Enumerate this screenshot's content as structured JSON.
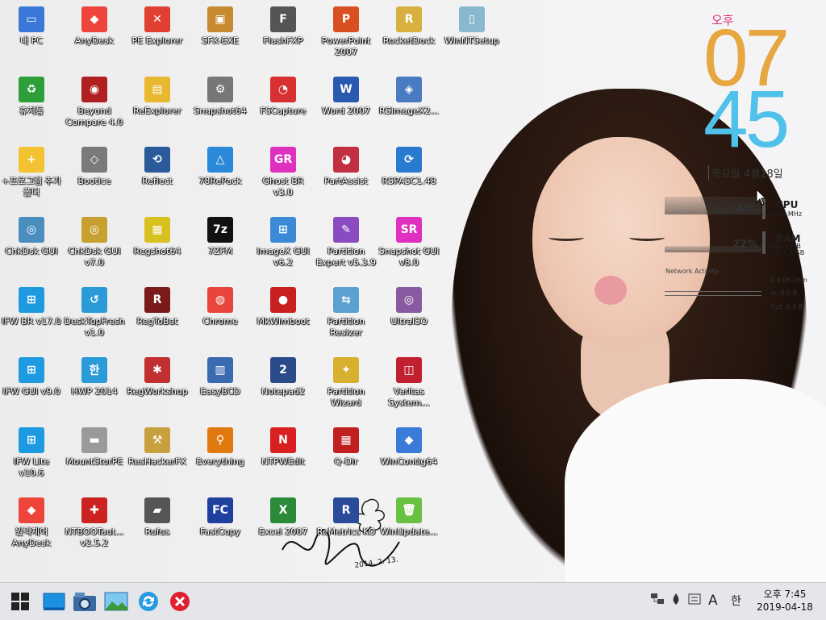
{
  "desktop_icons": [
    {
      "label": "내 PC",
      "icon": "monitor-icon",
      "color": "#3a78d8",
      "glyph": "▭"
    },
    {
      "label": "휴지통",
      "icon": "recycle-bin-icon",
      "color": "#2e9e3a",
      "glyph": "♻"
    },
    {
      "label": "+프로그램 추가 폴더",
      "icon": "folder-add-icon",
      "color": "#f2c230",
      "glyph": "+"
    },
    {
      "label": "ChkDsk GUI",
      "icon": "disk-check-icon",
      "color": "#4a8ec0",
      "glyph": "◎"
    },
    {
      "label": "IFW BR v17.0",
      "icon": "windows-tile-icon",
      "color": "#1e9be0",
      "glyph": "⊞"
    },
    {
      "label": "IFW GUI v9.0",
      "icon": "windows-tile-icon",
      "color": "#1e9be0",
      "glyph": "⊞"
    },
    {
      "label": "IFW Lite v10.6",
      "icon": "windows-tile-icon",
      "color": "#1e9be0",
      "glyph": "⊞"
    },
    {
      "label": "원격제어 AnyDesk",
      "icon": "anydesk-icon",
      "color": "#ef443b",
      "glyph": "◆"
    },
    {
      "label": "AnyDesk",
      "icon": "anydesk-icon",
      "color": "#ef443b",
      "glyph": "◆"
    },
    {
      "label": "Beyond Compare 4.0",
      "icon": "beyond-compare-icon",
      "color": "#b02020",
      "glyph": "◉"
    },
    {
      "label": "Bootice",
      "icon": "bootice-icon",
      "color": "#7a7a7a",
      "glyph": "◇"
    },
    {
      "label": "ChkDsk GUI v7.0",
      "icon": "disk-check-icon",
      "color": "#c8a030",
      "glyph": "◎"
    },
    {
      "label": "DeskTopFresh v1.0",
      "icon": "refresh-arrow-icon",
      "color": "#2a9ad8",
      "glyph": "↺"
    },
    {
      "label": "HWP 2014",
      "icon": "hwp-icon",
      "color": "#2a9ad8",
      "glyph": "한"
    },
    {
      "label": "MountStorPE",
      "icon": "drive-icon",
      "color": "#9a9a9a",
      "glyph": "▬"
    },
    {
      "label": "NTBOOTaut... v2.5.2",
      "icon": "toolbox-icon",
      "color": "#cc2222",
      "glyph": "✚"
    },
    {
      "label": "PE Explorer",
      "icon": "pe-explorer-icon",
      "color": "#e04030",
      "glyph": "✕"
    },
    {
      "label": "ReExplorer",
      "icon": "folder-window-icon",
      "color": "#e8b830",
      "glyph": "▤"
    },
    {
      "label": "Reflect",
      "icon": "reflect-icon",
      "color": "#2a5a9a",
      "glyph": "⟲"
    },
    {
      "label": "Regshot64",
      "icon": "regshot-icon",
      "color": "#d8c020",
      "glyph": "▦"
    },
    {
      "label": "RegToBat",
      "icon": "regtobat-icon",
      "color": "#7a1a1a",
      "glyph": "R"
    },
    {
      "label": "RegWorkshop",
      "icon": "regworkshop-icon",
      "color": "#c03030",
      "glyph": "✱"
    },
    {
      "label": "ResHackerFX",
      "icon": "reshacker-icon",
      "color": "#c8a040",
      "glyph": "⚒"
    },
    {
      "label": "Rufus",
      "icon": "usb-drive-icon",
      "color": "#555555",
      "glyph": "▰"
    },
    {
      "label": "SFX-EXE",
      "icon": "package-icon",
      "color": "#c88a30",
      "glyph": "▣"
    },
    {
      "label": "Snapshot64",
      "icon": "snapshot-icon",
      "color": "#777777",
      "glyph": "⚙"
    },
    {
      "label": "78RePack",
      "icon": "repack-icon",
      "color": "#2a8ad8",
      "glyph": "△"
    },
    {
      "label": "7ZFM",
      "icon": "seven-zip-icon",
      "color": "#111111",
      "glyph": "7z"
    },
    {
      "label": "Chrome",
      "icon": "chrome-icon",
      "color": "#e8453c",
      "glyph": "◍"
    },
    {
      "label": "EasyBCD",
      "icon": "easybcd-icon",
      "color": "#3a6ab0",
      "glyph": "▥"
    },
    {
      "label": "Everything",
      "icon": "magnifier-icon",
      "color": "#e07a10",
      "glyph": "⚲"
    },
    {
      "label": "FastCopy",
      "icon": "fastcopy-icon",
      "color": "#2040a0",
      "glyph": "FC"
    },
    {
      "label": "FlashFXP",
      "icon": "flashfxp-icon",
      "color": "#555555",
      "glyph": "F"
    },
    {
      "label": "FSCapture",
      "icon": "fscapture-icon",
      "color": "#d83030",
      "glyph": "◔"
    },
    {
      "label": "Ghost BR v3.0",
      "icon": "ghost-br-icon",
      "color": "#e030c0",
      "glyph": "GR"
    },
    {
      "label": "ImageX GUI v6.2",
      "icon": "windows-flag-icon",
      "color": "#3a8ad8",
      "glyph": "⊞"
    },
    {
      "label": "MkWimboot",
      "icon": "ladybug-icon",
      "color": "#c82020",
      "glyph": "●"
    },
    {
      "label": "Notepad2",
      "icon": "notepad2-icon",
      "color": "#2a4a8a",
      "glyph": "2"
    },
    {
      "label": "NTPWEdit",
      "icon": "ntpwedit-icon",
      "color": "#d82020",
      "glyph": "N"
    },
    {
      "label": "Excel 2007",
      "icon": "excel-icon",
      "color": "#2a8a3a",
      "glyph": "X"
    },
    {
      "label": "PowerPoint 2007",
      "icon": "powerpoint-icon",
      "color": "#d85020",
      "glyph": "P"
    },
    {
      "label": "Word 2007",
      "icon": "word-icon",
      "color": "#2a5ab0",
      "glyph": "W"
    },
    {
      "label": "PartAssist",
      "icon": "partassist-icon",
      "color": "#c03040",
      "glyph": "◕"
    },
    {
      "label": "Partition Expert v5.3.9",
      "icon": "partition-expert-icon",
      "color": "#8a4ac0",
      "glyph": "✎"
    },
    {
      "label": "Partition Resizer",
      "icon": "partition-resizer-icon",
      "color": "#5aa0d0",
      "glyph": "⇆"
    },
    {
      "label": "Partition Wizard",
      "icon": "partition-wizard-icon",
      "color": "#d8b030",
      "glyph": "✦"
    },
    {
      "label": "Q-Dir",
      "icon": "q-dir-icon",
      "color": "#c02020",
      "glyph": "▦"
    },
    {
      "label": "ReMetrics KO",
      "icon": "remetrics-icon",
      "color": "#2a4a9a",
      "glyph": "R"
    },
    {
      "label": "RocketDock",
      "icon": "rocketdock-icon",
      "color": "#d8b040",
      "glyph": "R"
    },
    {
      "label": "RSImageX2...",
      "icon": "rsimagex-icon",
      "color": "#4a7ac0",
      "glyph": "◈"
    },
    {
      "label": "RSPASC1.48",
      "icon": "rspasc-icon",
      "color": "#2a7ad0",
      "glyph": "⟳"
    },
    {
      "label": "Snapshot GUI v8.0",
      "icon": "snapshot-gui-icon",
      "color": "#e030c0",
      "glyph": "SR"
    },
    {
      "label": "UltraISO",
      "icon": "disc-icon",
      "color": "#8a5aa0",
      "glyph": "◎"
    },
    {
      "label": "Veritas System...",
      "icon": "veritas-icon",
      "color": "#c02030",
      "glyph": "◫"
    },
    {
      "label": "WinContig64",
      "icon": "wincontig-icon",
      "color": "#3a7ad8",
      "glyph": "◆"
    },
    {
      "label": "WinUpdate...",
      "icon": "trash-green-icon",
      "color": "#6ac040",
      "glyph": "🗑"
    },
    {
      "label": "WinNTSetup",
      "icon": "winntsetup-icon",
      "color": "#8ab8d0",
      "glyph": "▯"
    }
  ],
  "clock_widget": {
    "ampm": "오후",
    "hour": "07",
    "minute": "45",
    "date": "목요일 4월18일",
    "hour_color": "#e6a640",
    "minute_color": "#4fc1ea",
    "ampm_color": "#e0327a"
  },
  "system_meter": {
    "cpu_percent": "4%",
    "cpu_label": "CPU",
    "cpu_speed": "2500 MHz",
    "ram_percent": "22%",
    "ram_label": "RAM",
    "ram_used": "941.1 MB",
    "ram_total": "of  4.2 GB",
    "network_label": "Network Activity",
    "uptime": "0 d 0h 06m",
    "net_in": "In: 0.0 B",
    "net_out": "Out: 0.0 B"
  },
  "wallpaper": {
    "signature_date": "2014. 2. 13."
  },
  "taskbar": {
    "start_icon": "windows-start-icon",
    "pinned": [
      {
        "icon": "desktop-icon",
        "color": "#1e90e0"
      },
      {
        "icon": "camera-folder-icon",
        "color": "#3a6aa0"
      },
      {
        "icon": "landscape-image-icon",
        "color": "#3a9ad8"
      },
      {
        "icon": "sync-icon",
        "color": "#2a9ae0"
      },
      {
        "icon": "close-circle-icon",
        "color": "#e02030"
      }
    ],
    "tray": {
      "network_glyph": "🖧",
      "drop_glyph": "💧",
      "ime_mode": "A",
      "ime_lang": "한",
      "time": "오후 7:45",
      "date": "2019-04-18"
    }
  }
}
